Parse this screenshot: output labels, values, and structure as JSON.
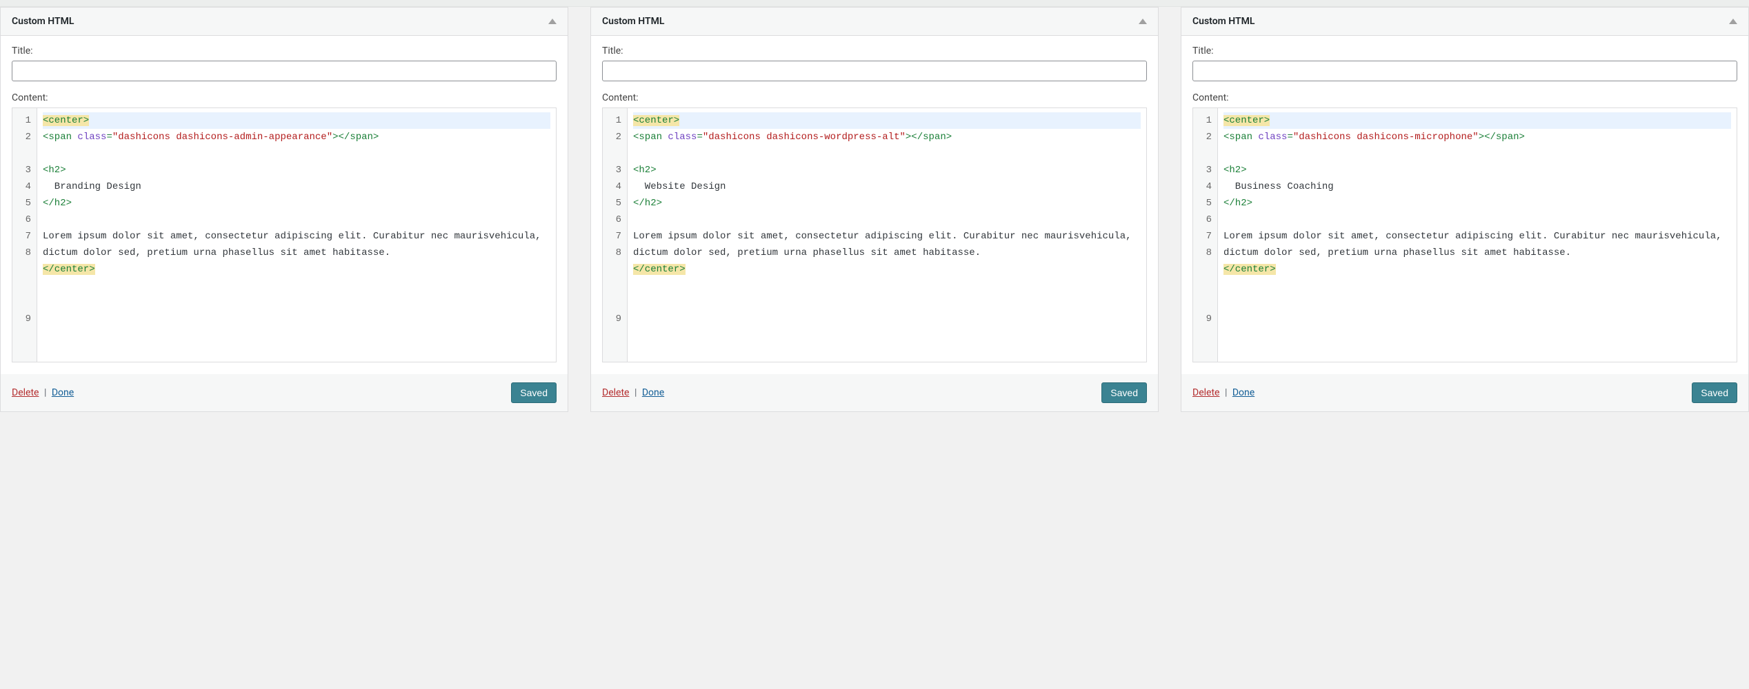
{
  "widgets": [
    {
      "header": "Custom HTML",
      "titleLabel": "Title:",
      "titleValue": "",
      "contentLabel": "Content:",
      "deleteLabel": "Delete",
      "sep": "|",
      "doneLabel": "Done",
      "savedLabel": "Saved",
      "code": {
        "lineNumbers": [
          "1",
          "2",
          "",
          "3",
          "4",
          "5",
          "6",
          "7",
          "8",
          "",
          "",
          "",
          "9"
        ],
        "span_class": "dashicons dashicons-admin-appearance",
        "h2_text": "Branding Design",
        "paragraph": "Lorem ipsum dolor sit amet, consectetur adipiscing elit. Curabitur nec maurisvehicula, dictum dolor sed, pretium urna phasellus sit amet habitasse."
      }
    },
    {
      "header": "Custom HTML",
      "titleLabel": "Title:",
      "titleValue": "",
      "contentLabel": "Content:",
      "deleteLabel": "Delete",
      "sep": "|",
      "doneLabel": "Done",
      "savedLabel": "Saved",
      "code": {
        "lineNumbers": [
          "1",
          "2",
          "",
          "3",
          "4",
          "5",
          "6",
          "7",
          "8",
          "",
          "",
          "",
          "9"
        ],
        "span_class": "dashicons dashicons-wordpress-alt",
        "h2_text": "Website Design",
        "paragraph": "Lorem ipsum dolor sit amet, consectetur adipiscing elit. Curabitur nec maurisvehicula, dictum dolor sed, pretium urna phasellus sit amet habitasse."
      }
    },
    {
      "header": "Custom HTML",
      "titleLabel": "Title:",
      "titleValue": "",
      "contentLabel": "Content:",
      "deleteLabel": "Delete",
      "sep": "|",
      "doneLabel": "Done",
      "savedLabel": "Saved",
      "code": {
        "lineNumbers": [
          "1",
          "2",
          "",
          "3",
          "4",
          "5",
          "6",
          "7",
          "8",
          "",
          "",
          "",
          "9"
        ],
        "span_class": "dashicons dashicons-microphone",
        "h2_text": "Business Coaching",
        "paragraph": "Lorem ipsum dolor sit amet, consectetur adipiscing elit. Curabitur nec maurisvehicula, dictum dolor sed, pretium urna phasellus sit amet habitasse."
      }
    }
  ]
}
